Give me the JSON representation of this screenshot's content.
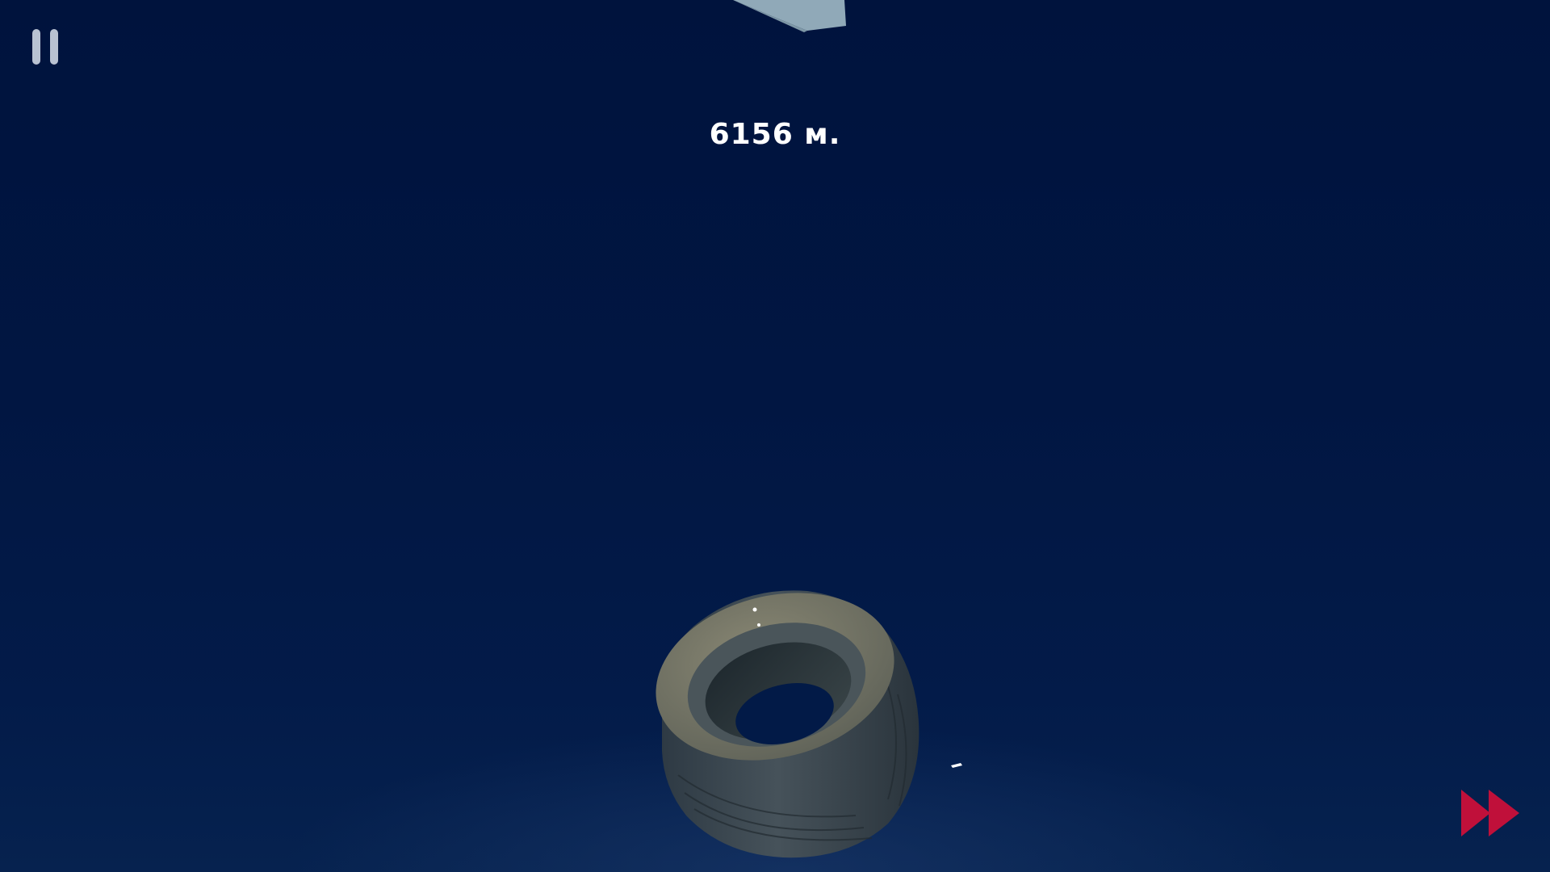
{
  "hud": {
    "distance_text": "6156 м.",
    "pause_icon": "pause-icon",
    "fast_forward_icon": "fast-forward-icon"
  },
  "colors": {
    "background": "#011642",
    "hud_text": "#ffffff",
    "pause_icon": "#b9c2d2",
    "fast_forward": "#c0103a",
    "debris": "#90a9b8",
    "tire_rubber": "#3a4650",
    "tire_rim": "#7b7a68"
  },
  "scene": {
    "objects": [
      "falling-debris",
      "tire",
      "spark"
    ]
  }
}
